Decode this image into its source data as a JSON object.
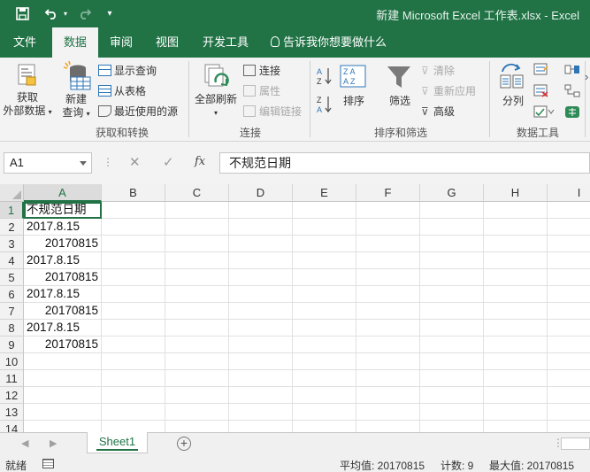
{
  "window": {
    "title": "新建 Microsoft Excel 工作表.xlsx  -  Excel",
    "brand_color": "#217346"
  },
  "quick_access": [
    "save-icon",
    "undo-icon",
    "redo-icon",
    "customize-icon"
  ],
  "tabs": [
    {
      "label": "文件"
    },
    {
      "label": "数据",
      "active": true
    },
    {
      "label": "审阅"
    },
    {
      "label": "视图"
    },
    {
      "label": "开发工具"
    }
  ],
  "tell_me": "告诉我你想要做什么",
  "ribbon": {
    "get_external": {
      "line1": "获取",
      "line2": "外部数据"
    },
    "new_query": {
      "line1": "新建",
      "line2": "查询"
    },
    "show_queries": "显示查询",
    "from_table": "从表格",
    "recent_sources": "最近使用的源",
    "group_get_transform": "获取和转换",
    "refresh_all": "全部刷新",
    "connections": "连接",
    "properties": "属性",
    "edit_links": "编辑链接",
    "group_connections": "连接",
    "sort": "排序",
    "filter": "筛选",
    "clear": "清除",
    "reapply": "重新应用",
    "advanced": "高级",
    "group_sort_filter": "排序和筛选",
    "text_to_columns": "分列",
    "group_data_tools": "数据工具"
  },
  "formula_bar": {
    "name_box": "A1",
    "formula": "不规范日期"
  },
  "columns": [
    "A",
    "B",
    "C",
    "D",
    "E",
    "F",
    "G",
    "H",
    "I"
  ],
  "rows": [
    {
      "n": "1",
      "a": "不规范日期",
      "numeric": false
    },
    {
      "n": "2",
      "a": "2017.8.15",
      "numeric": false
    },
    {
      "n": "3",
      "a": "20170815",
      "numeric": true
    },
    {
      "n": "4",
      "a": "2017.8.15",
      "numeric": false
    },
    {
      "n": "5",
      "a": "20170815",
      "numeric": true
    },
    {
      "n": "6",
      "a": "2017.8.15",
      "numeric": false
    },
    {
      "n": "7",
      "a": "20170815",
      "numeric": true
    },
    {
      "n": "8",
      "a": "2017.8.15",
      "numeric": false
    },
    {
      "n": "9",
      "a": "20170815",
      "numeric": true
    },
    {
      "n": "10",
      "a": "",
      "numeric": false
    },
    {
      "n": "11",
      "a": "",
      "numeric": false
    },
    {
      "n": "12",
      "a": "",
      "numeric": false
    },
    {
      "n": "13",
      "a": "",
      "numeric": false
    },
    {
      "n": "14",
      "a": "",
      "numeric": false
    }
  ],
  "sheets": [
    {
      "label": "Sheet1",
      "active": true
    }
  ],
  "status": {
    "mode": "就绪",
    "average": "平均值: 20170815",
    "count": "计数: 9",
    "max": "最大值: 20170815"
  }
}
